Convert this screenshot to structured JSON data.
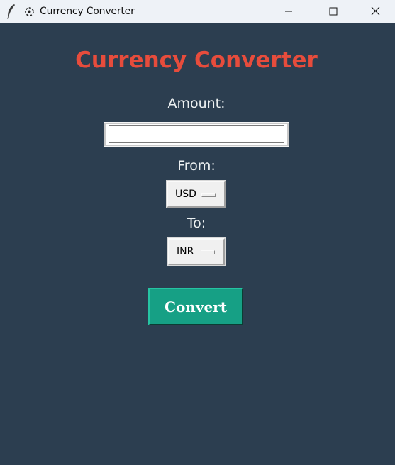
{
  "window": {
    "title": "Currency Converter",
    "background": "#2c3e50",
    "controls": {
      "minimize": "minimize-icon",
      "maximize": "maximize-icon",
      "close": "close-icon"
    }
  },
  "main": {
    "heading": "Currency Converter",
    "heading_color": "#e74c3c",
    "amount_label": "Amount:",
    "amount_value": "",
    "from_label": "From:",
    "from_value": "USD",
    "to_label": "To:",
    "to_value": "INR",
    "convert_label": "Convert",
    "convert_color": "#16a085"
  }
}
